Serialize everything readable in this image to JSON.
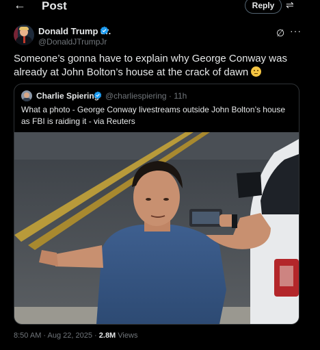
{
  "header": {
    "back_glyph": "←",
    "title": "Post",
    "reply_label": "Reply",
    "settings_glyph": "⇌"
  },
  "tweet": {
    "author_name": "Donald Trump Jr.",
    "author_handle": "@DonaldJTrumpJr",
    "verified": true,
    "grok_glyph": "∅",
    "more_glyph": "···",
    "text": "Someone’s gonna have to explain why George Conway was already at John Bolton’s house at the crack of dawn",
    "emoji": "thinking-face",
    "timestamp": "8:50 AM · Aug 22, 2025 ·",
    "views_count": "2.8M",
    "views_label": "Views"
  },
  "quoted": {
    "author_name": "Charlie Spiering",
    "meta": "@charliespiering · 11h",
    "verified": true,
    "text": "What a photo - George Conway livestreams outside John Bolton’s house as FBI is raiding it - via Reuters"
  },
  "colors": {
    "background": "#000000",
    "text": "#e7e9ea",
    "muted": "#71767b",
    "verified": "#1d9bf0",
    "border": "#2f3336"
  }
}
